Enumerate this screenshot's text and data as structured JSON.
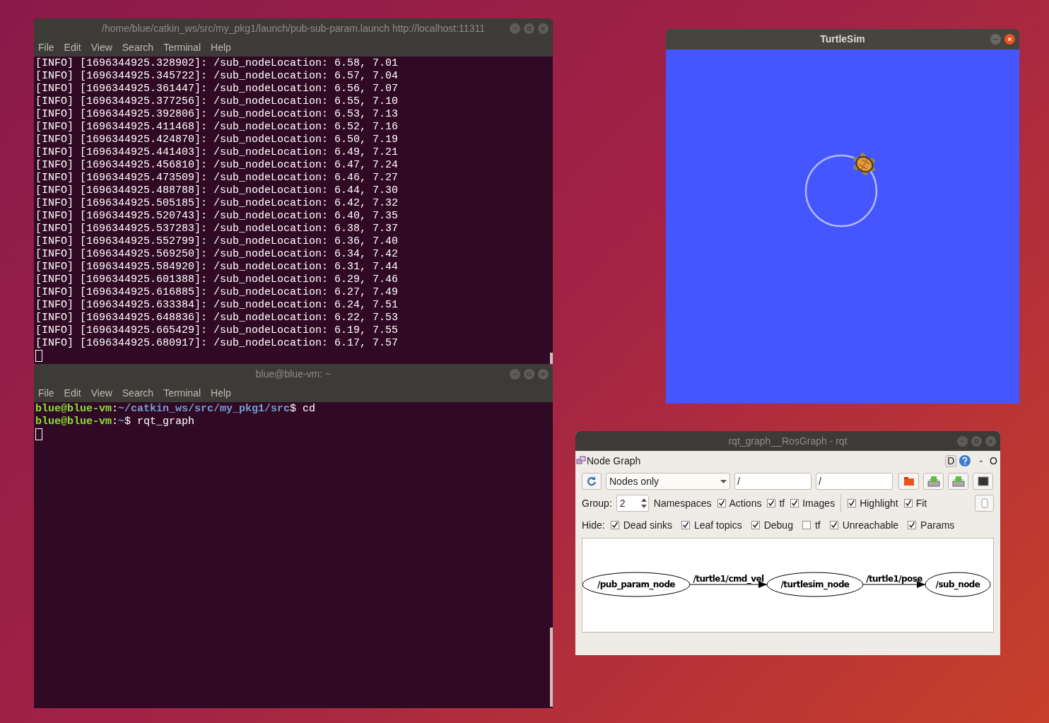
{
  "terminals": [
    {
      "title": "/home/blue/catkin_ws/src/my_pkg1/launch/pub-sub-param.launch http://localhost:11311",
      "menu": [
        "File",
        "Edit",
        "View",
        "Search",
        "Terminal",
        "Help"
      ],
      "lines": [
        {
          "kind": "log",
          "text": "[INFO] [1696344925.328902]: /sub_nodeLocation: 6.58, 7.01"
        },
        {
          "kind": "log",
          "text": "[INFO] [1696344925.345722]: /sub_nodeLocation: 6.57, 7.04"
        },
        {
          "kind": "log",
          "text": "[INFO] [1696344925.361447]: /sub_nodeLocation: 6.56, 7.07"
        },
        {
          "kind": "log",
          "text": "[INFO] [1696344925.377256]: /sub_nodeLocation: 6.55, 7.10"
        },
        {
          "kind": "log",
          "text": "[INFO] [1696344925.392806]: /sub_nodeLocation: 6.53, 7.13"
        },
        {
          "kind": "log",
          "text": "[INFO] [1696344925.411468]: /sub_nodeLocation: 6.52, 7.16"
        },
        {
          "kind": "log",
          "text": "[INFO] [1696344925.424870]: /sub_nodeLocation: 6.50, 7.19"
        },
        {
          "kind": "log",
          "text": "[INFO] [1696344925.441403]: /sub_nodeLocation: 6.49, 7.21"
        },
        {
          "kind": "log",
          "text": "[INFO] [1696344925.456810]: /sub_nodeLocation: 6.47, 7.24"
        },
        {
          "kind": "log",
          "text": "[INFO] [1696344925.473509]: /sub_nodeLocation: 6.46, 7.27"
        },
        {
          "kind": "log",
          "text": "[INFO] [1696344925.488788]: /sub_nodeLocation: 6.44, 7.30"
        },
        {
          "kind": "log",
          "text": "[INFO] [1696344925.505185]: /sub_nodeLocation: 6.42, 7.32"
        },
        {
          "kind": "log",
          "text": "[INFO] [1696344925.520743]: /sub_nodeLocation: 6.40, 7.35"
        },
        {
          "kind": "log",
          "text": "[INFO] [1696344925.537283]: /sub_nodeLocation: 6.38, 7.37"
        },
        {
          "kind": "log",
          "text": "[INFO] [1696344925.552799]: /sub_nodeLocation: 6.36, 7.40"
        },
        {
          "kind": "log",
          "text": "[INFO] [1696344925.569250]: /sub_nodeLocation: 6.34, 7.42"
        },
        {
          "kind": "log",
          "text": "[INFO] [1696344925.584920]: /sub_nodeLocation: 6.31, 7.44"
        },
        {
          "kind": "log",
          "text": "[INFO] [1696344925.601388]: /sub_nodeLocation: 6.29, 7.46"
        },
        {
          "kind": "log",
          "text": "[INFO] [1696344925.616885]: /sub_nodeLocation: 6.27, 7.49"
        },
        {
          "kind": "log",
          "text": "[INFO] [1696344925.633384]: /sub_nodeLocation: 6.24, 7.51"
        },
        {
          "kind": "log",
          "text": "[INFO] [1696344925.648836]: /sub_nodeLocation: 6.22, 7.53"
        },
        {
          "kind": "log",
          "text": "[INFO] [1696344925.665429]: /sub_nodeLocation: 6.19, 7.55"
        },
        {
          "kind": "log",
          "text": "[INFO] [1696344925.680917]: /sub_nodeLocation: 6.17, 7.57"
        }
      ]
    },
    {
      "title": "blue@blue-vm: ~",
      "menu": [
        "File",
        "Edit",
        "View",
        "Search",
        "Terminal",
        "Help"
      ],
      "lines": [
        {
          "kind": "prompt",
          "user": "blue@blue-vm",
          "separator": ":",
          "path": "~/catkin_ws/src/my_pkg1/src",
          "command": "$ cd"
        },
        {
          "kind": "prompt",
          "user": "blue@blue-vm",
          "separator": ":",
          "path": "~",
          "command": "$ rqt_graph"
        }
      ]
    }
  ],
  "turtlesim": {
    "title": "TurtleSim"
  },
  "rqt": {
    "title": "rqt_graph__RosGraph - rqt",
    "plugin": "Node Graph",
    "corner_buttons": [
      "D",
      "-",
      "O"
    ],
    "mode": "Nodes only",
    "filters": [
      "/",
      "/"
    ],
    "group_label": "Group:",
    "group": "2",
    "row1": [
      {
        "kind": "label",
        "label": "Namespaces"
      },
      {
        "kind": "check",
        "label": "Actions",
        "checked": true
      },
      {
        "kind": "check",
        "label": "tf",
        "checked": true
      },
      {
        "kind": "check",
        "label": "Images",
        "checked": true
      },
      {
        "kind": "separator"
      },
      {
        "kind": "check",
        "label": "Highlight",
        "checked": true
      },
      {
        "kind": "check",
        "label": "Fit",
        "checked": true
      }
    ],
    "hide_label": "Hide:",
    "row2": [
      {
        "label": "Dead sinks",
        "checked": true
      },
      {
        "label": "Leaf topics",
        "checked": true
      },
      {
        "label": "Debug",
        "checked": true
      },
      {
        "label": "tf",
        "checked": false
      },
      {
        "label": "Unreachable",
        "checked": true
      },
      {
        "label": "Params",
        "checked": true
      }
    ],
    "graph": {
      "nodes": [
        "/pub_param_node",
        "/turtlesim_node",
        "/sub_node"
      ],
      "edges": [
        {
          "label": "/turtle1/cmd_vel"
        },
        {
          "label": "/turtle1/pose"
        }
      ]
    }
  }
}
